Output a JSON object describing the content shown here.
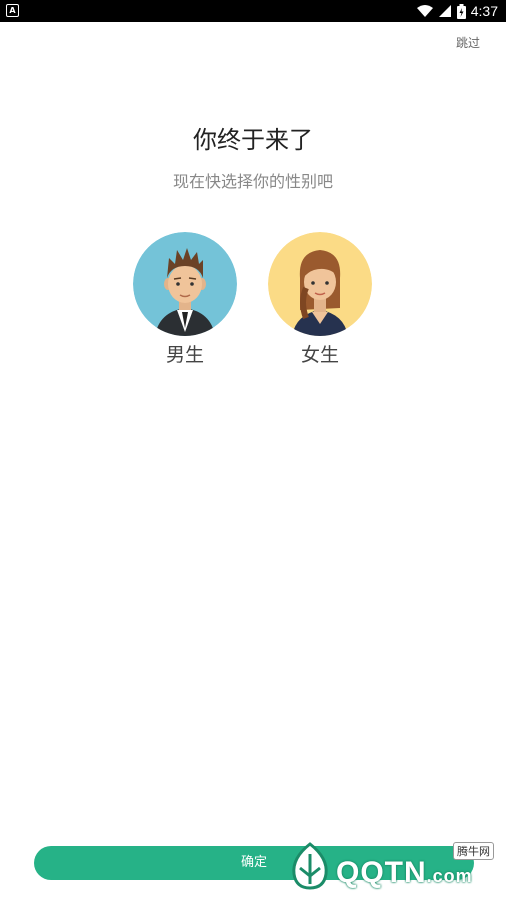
{
  "status_bar": {
    "time": "4:37",
    "app_icon": "A"
  },
  "header": {
    "skip_label": "跳过"
  },
  "main": {
    "title": "你终于来了",
    "subtitle": "现在快选择你的性别吧",
    "options": [
      {
        "label": "男生",
        "icon": "male-avatar",
        "bg": "#74C3D8"
      },
      {
        "label": "女生",
        "icon": "female-avatar",
        "bg": "#FBDB86"
      }
    ]
  },
  "footer": {
    "confirm_label": "确定"
  },
  "watermark": {
    "text": "QQTN",
    "suffix": ".com",
    "badge": "腾牛网"
  },
  "colors": {
    "accent": "#26B287"
  }
}
